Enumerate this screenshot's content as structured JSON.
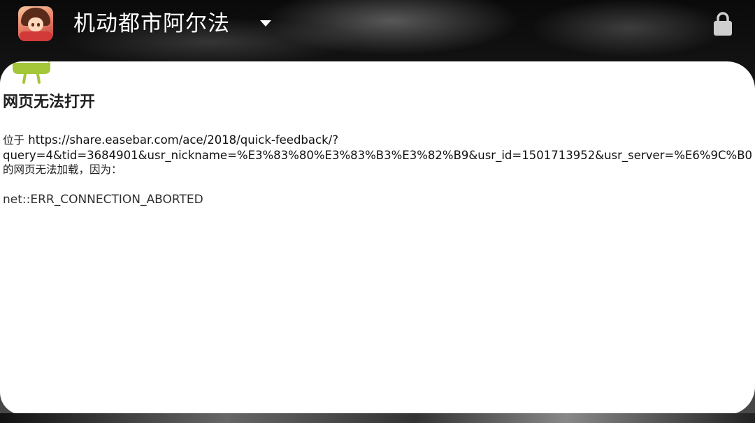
{
  "app_bar": {
    "title": "机动都市阿尔法",
    "app_icon": "game-character-icon",
    "dropdown_icon": "dropdown-triangle-icon",
    "lock_icon": "lock-icon"
  },
  "error_page": {
    "icon": "android-icon",
    "title": "网页无法打开",
    "prefix": "位于",
    "url_line1": "https://share.easebar.com/ace/2018/quick-feedback/?",
    "url_line2": "query=4&tid=3684901&usr_nickname=%E3%83%80%E3%83%B3%E3%82%B9&usr_id=1501713952&usr_server=%E6%9C%B0",
    "suffix": "的网页无法加载，因为：",
    "error_code": "net::ERR_CONNECTION_ABORTED"
  },
  "colors": {
    "background": "#000000",
    "card": "#ffffff",
    "android_green": "#a4c639",
    "text": "#202020"
  }
}
